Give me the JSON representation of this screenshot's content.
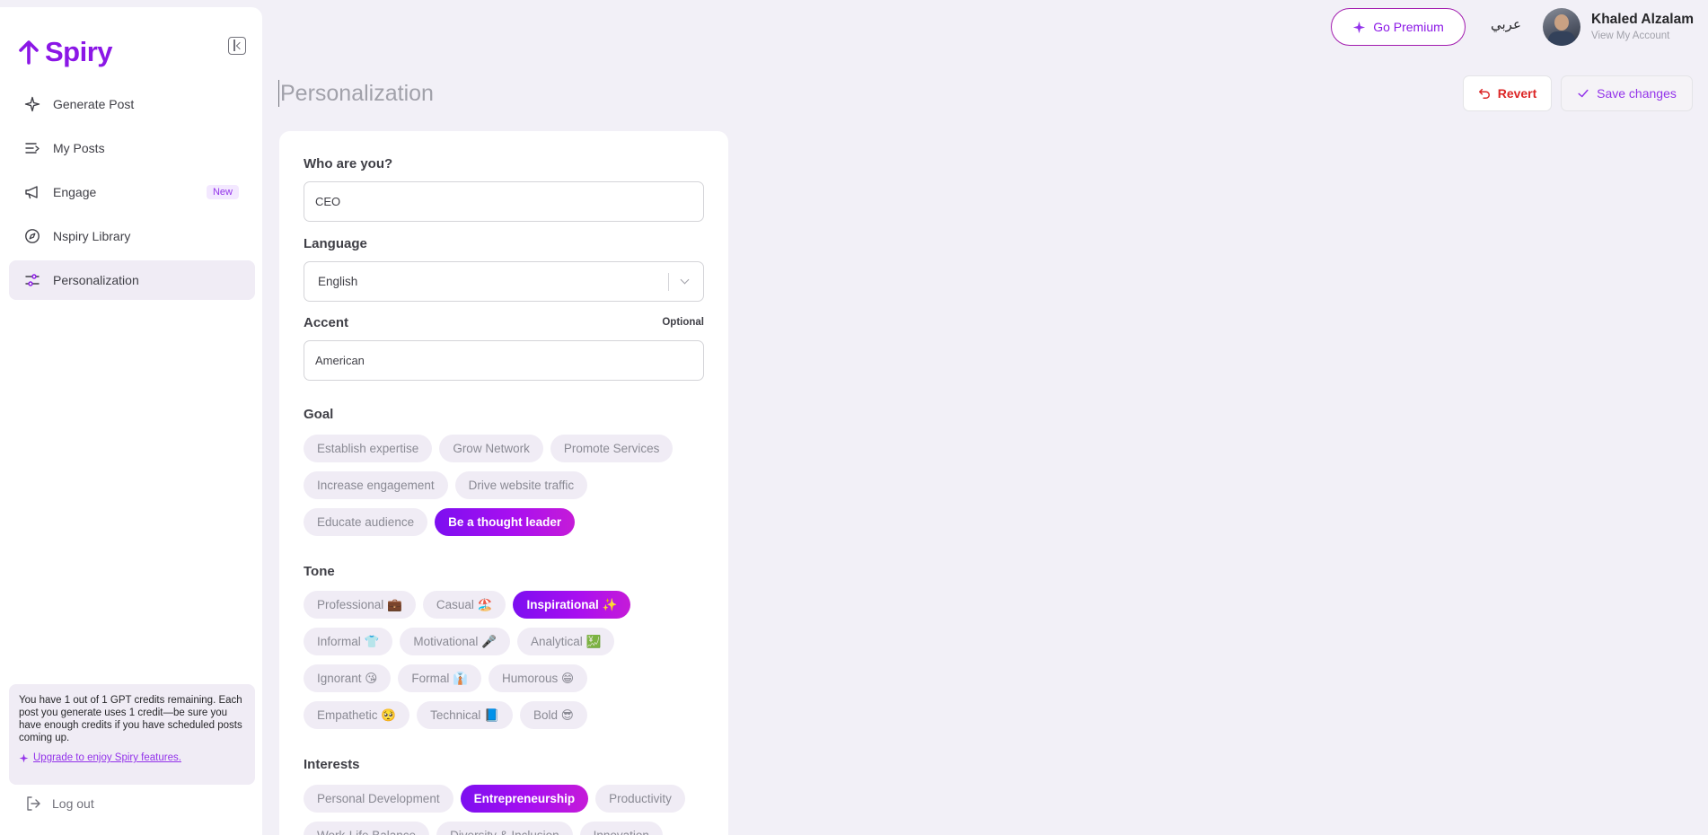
{
  "app": {
    "logo_text": "Spiry"
  },
  "sidebar": {
    "items": [
      {
        "label": "Generate Post",
        "icon": "sparkle-icon"
      },
      {
        "label": "My Posts",
        "icon": "list-icon"
      },
      {
        "label": "Engage",
        "icon": "megaphone-icon",
        "badge": "New"
      },
      {
        "label": "Nspiry Library",
        "icon": "compass-icon"
      },
      {
        "label": "Personalization",
        "icon": "sliders-icon",
        "active": true
      }
    ],
    "credits_text": "You have 1 out of 1 GPT credits remaining. Each post you generate uses 1 credit—be sure you have enough credits if you have scheduled posts coming up.",
    "upgrade_link": "Upgrade to enjoy Spiry features.",
    "logout_label": "Log out"
  },
  "topbar": {
    "premium_label": "Go Premium",
    "language_toggle": "عربي",
    "user_name": "Khaled Alzalam",
    "user_link": "View My Account"
  },
  "header": {
    "title": "Personalization",
    "revert_label": "Revert",
    "save_label": "Save changes"
  },
  "form": {
    "who_label": "Who are you?",
    "who_value": "CEO",
    "language_label": "Language",
    "language_value": "English",
    "accent_label": "Accent",
    "accent_optional": "Optional",
    "accent_value": "American",
    "goal_label": "Goal",
    "goal_rows": [
      [
        {
          "label": "Establish expertise"
        },
        {
          "label": "Grow Network"
        },
        {
          "label": "Promote Services"
        }
      ],
      [
        {
          "label": "Increase engagement"
        },
        {
          "label": "Drive website traffic"
        }
      ],
      [
        {
          "label": "Educate audience"
        },
        {
          "label": "Be a thought leader",
          "selected": true
        }
      ]
    ],
    "tone_label": "Tone",
    "tone_rows": [
      [
        {
          "label": "Professional 💼"
        },
        {
          "label": "Casual 🏖️"
        },
        {
          "label": "Inspirational ✨",
          "selected": true
        }
      ],
      [
        {
          "label": "Informal 👕"
        },
        {
          "label": "Motivational 🎤"
        },
        {
          "label": "Analytical 💹"
        }
      ],
      [
        {
          "label": "Ignorant 😘"
        },
        {
          "label": "Formal 👔"
        },
        {
          "label": "Humorous 😁"
        }
      ],
      [
        {
          "label": "Empathetic 🥺"
        },
        {
          "label": "Technical 📘"
        },
        {
          "label": "Bold 😎"
        }
      ]
    ],
    "interests_label": "Interests",
    "interest_rows": [
      [
        {
          "label": "Personal Development"
        },
        {
          "label": "Entrepreneurship",
          "selected": true
        },
        {
          "label": "Productivity"
        }
      ],
      [
        {
          "label": "Work-Life Balance"
        },
        {
          "label": "Diversity & Inclusion"
        },
        {
          "label": "Innovation"
        }
      ]
    ]
  },
  "colors": {
    "brand": "#8b17e6",
    "selected_gradient_start": "#7c0ff0",
    "selected_gradient_end": "#c51bd8",
    "revert": "#dc2626",
    "background": "#f2f0f7"
  }
}
